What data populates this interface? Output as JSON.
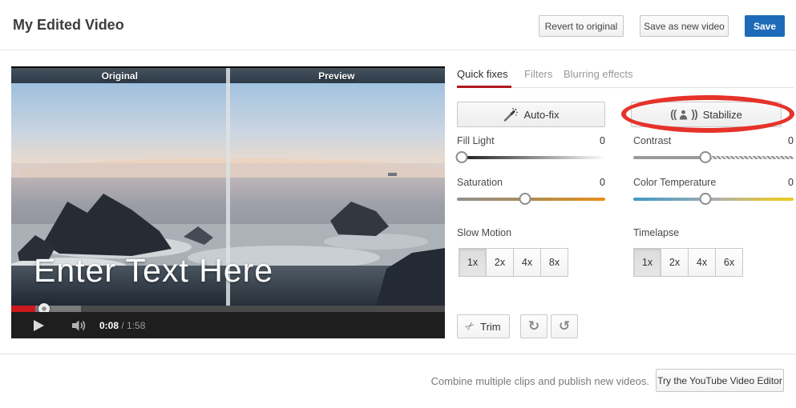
{
  "header": {
    "title": "My Edited Video",
    "revert_label": "Revert to original",
    "save_as_new_label": "Save as new video",
    "save_label": "Save"
  },
  "player": {
    "original_label": "Original",
    "preview_label": "Preview",
    "text_overlay": "Enter Text Here",
    "time_current": "0:08",
    "time_total": "/ 1:58",
    "progress": {
      "played_width": "5.5%",
      "buffered_width": "16%",
      "handle_left": "7.5%"
    }
  },
  "panel": {
    "tabs": [
      {
        "label": "Quick fixes",
        "active": true
      },
      {
        "label": "Filters",
        "active": false
      },
      {
        "label": "Blurring effects",
        "active": false
      }
    ],
    "autofix_label": "Auto-fix",
    "stabilize_label": "Stabilize",
    "stabilize_paren_left": "((",
    "stabilize_paren_right": "))",
    "sliders": [
      {
        "label": "Fill Light",
        "value": "0",
        "handle_left": "3%"
      },
      {
        "label": "Contrast",
        "value": "0",
        "handle_left": "45%"
      },
      {
        "label": "Saturation",
        "value": "0",
        "handle_left": "46%"
      },
      {
        "label": "Color Temperature",
        "value": "0",
        "handle_left": "45%"
      }
    ],
    "slow_motion": {
      "label": "Slow Motion",
      "options": [
        "1x",
        "2x",
        "4x",
        "8x"
      ],
      "selected": "1x"
    },
    "timelapse": {
      "label": "Timelapse",
      "options": [
        "1x",
        "2x",
        "4x",
        "6x"
      ],
      "selected": "1x"
    },
    "trim_label": "Trim",
    "icons": {
      "autofix": "magic-wand",
      "stabilize": "shaking-person",
      "trim_glyph": "✂",
      "redo_glyph": "↻",
      "undo_glyph": "↺"
    }
  },
  "footer": {
    "promo_text": "Combine multiple clips and publish new videos.",
    "editor_button_label": "Try the YouTube Video Editor"
  },
  "colors": {
    "tab_accent_red": "#b0191e",
    "save_button_blue": "#1d6bb8",
    "annotation_red": "#e5332a",
    "progress_played_red": "#cc181e"
  }
}
